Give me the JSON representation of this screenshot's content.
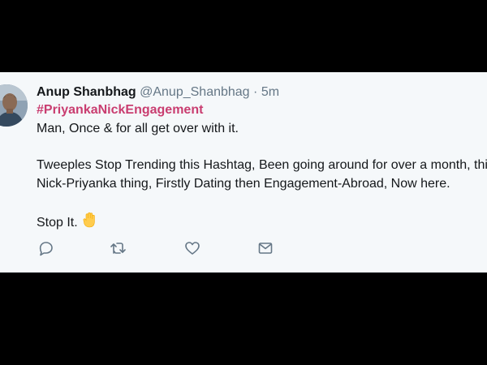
{
  "tweet": {
    "author_name": "Anup Shanbhag",
    "handle": "@Anup_Shanbhag",
    "separator": "·",
    "timestamp": "5m",
    "hashtag": "#PriyankaNickEngagement",
    "lines": [
      "Man, Once & for all get over with it.",
      "Tweeples Stop Trending this Hashtag, Been going around for over a month, this",
      "Nick-Priyanka thing, Firstly Dating then Engagement-Abroad, Now here.",
      "Stop It."
    ],
    "emoji": "raised-hand-emoji"
  },
  "actions": {
    "icons": [
      "reply-icon",
      "retweet-icon",
      "like-icon",
      "direct-message-icon"
    ]
  },
  "colors": {
    "background": "#000000",
    "card": "#f5f8fa",
    "hashtag": "#c93d70",
    "text": "#14171a",
    "muted": "#657786",
    "icon": "#657786"
  }
}
